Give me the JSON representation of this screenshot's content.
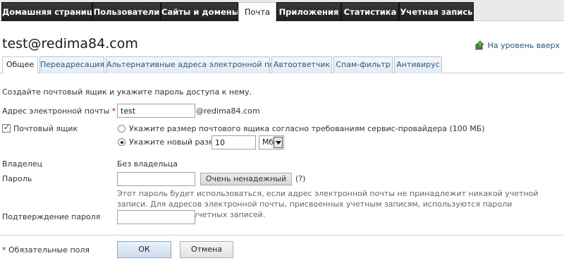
{
  "nav": {
    "tabs": [
      {
        "label": "Домашняя страница"
      },
      {
        "label": "Пользователи"
      },
      {
        "label": "Сайты и домены"
      },
      {
        "label": "Почта"
      },
      {
        "label": "Приложения"
      },
      {
        "label": "Статистика"
      },
      {
        "label": "Учетная запись"
      }
    ],
    "active_index": 3
  },
  "title": "test@redima84.com",
  "up_level": {
    "label": "На уровень вверх",
    "icon": "up-level-icon"
  },
  "subtabs": [
    {
      "label": "Общее"
    },
    {
      "label": "Переадресация"
    },
    {
      "label": "Альтернативные адреса электронной почты"
    },
    {
      "label": "Автоответчик"
    },
    {
      "label": "Спам-фильтр"
    },
    {
      "label": "Антивирус"
    }
  ],
  "intro": "Создайте почтовый ящик и укажите пароль доступа к нему.",
  "form": {
    "email": {
      "label": "Адрес электронной почты",
      "required_mark": "*",
      "value": "test",
      "domain": "@redima84.com"
    },
    "mailbox": {
      "label": "Почтовый ящик",
      "checked": true,
      "option_default": "Укажите размер почтового ящика согласно требованиям сервис-провайдера (100 МБ)",
      "option_custom": "Укажите новый размер",
      "size_value": "10",
      "unit": "Мб"
    },
    "owner": {
      "label": "Владелец",
      "value": "Без владельца"
    },
    "password": {
      "label": "Пароль",
      "value": "",
      "strength": "Очень ненадежный",
      "help": "(?)"
    },
    "hint": "Этот пароль будет использоваться, если адрес электронной почты не принадлежит никакой учетной записи. Для адресов электронной почты, присвоенных учетным записям, используются пароли соответствующих учетных записей.",
    "confirm": {
      "label": "Подтверждение пароля",
      "value": ""
    }
  },
  "footer": {
    "required_mark": "*",
    "required_note": "Обязательные поля",
    "ok": "ОК",
    "cancel": "Отмена"
  },
  "colors": {
    "accent": "#1f5a8a",
    "nav_bg": "#1e1e1e",
    "required": "#d0021b"
  }
}
